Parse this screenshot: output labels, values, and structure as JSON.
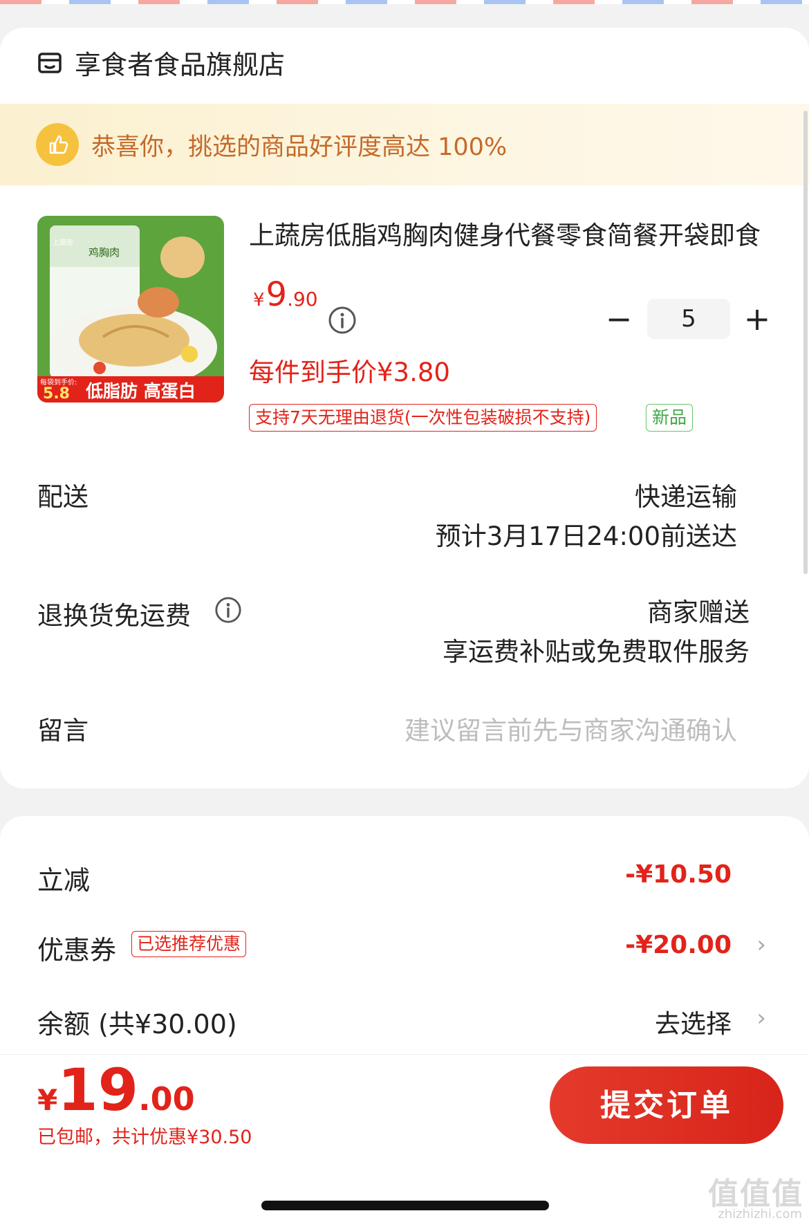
{
  "store": {
    "name": "享食者食品旗舰店",
    "icon": "store-icon"
  },
  "banner": {
    "text": "恭喜你，挑选的商品好评度高达 100%",
    "icon": "thumbs-up-icon"
  },
  "product": {
    "title": "上蔬房低脂鸡胸肉健身代餐零食简餐开袋即食",
    "price_currency": "¥",
    "price_int": "9",
    "price_dec": ".90",
    "per_piece": "每件到手价¥3.80",
    "quantity": "5",
    "tag_return": "支持7天无理由退货(一次性包装破损不支持)",
    "tag_new": "新品",
    "image": {
      "brand": "上蔬房",
      "label": "鸡胸肉",
      "price_caption": "每袋到手价:",
      "price": "5.8",
      "slogan": "低脂肪 高蛋白"
    }
  },
  "delivery": {
    "label": "配送",
    "method": "快递运输",
    "eta": "预计3月17日24:00前送达"
  },
  "return_shipping": {
    "label": "退换货免运费",
    "value": "商家赠送",
    "desc": "享运费补贴或免费取件服务"
  },
  "message": {
    "label": "留言",
    "placeholder": "建议留言前先与商家沟通确认"
  },
  "summary": {
    "instant_discount_label": "立减",
    "instant_discount_value": "-¥10.50",
    "coupon_label": "优惠券",
    "coupon_tag": "已选推荐优惠",
    "coupon_value": "-¥20.00",
    "balance_label": "余额 (共¥30.00)",
    "balance_action": "去选择"
  },
  "footer": {
    "total_currency": "¥",
    "total_int": "19",
    "total_dec": ".00",
    "total_sub": "已包邮，共计优惠¥30.50",
    "submit_label": "提交订单"
  },
  "watermark": {
    "text": "值值值",
    "sub": "zhizhizhi.com"
  },
  "colors": {
    "accent": "#e2231a",
    "banner_text": "#c46a2a",
    "new_tag": "#3fa847"
  }
}
